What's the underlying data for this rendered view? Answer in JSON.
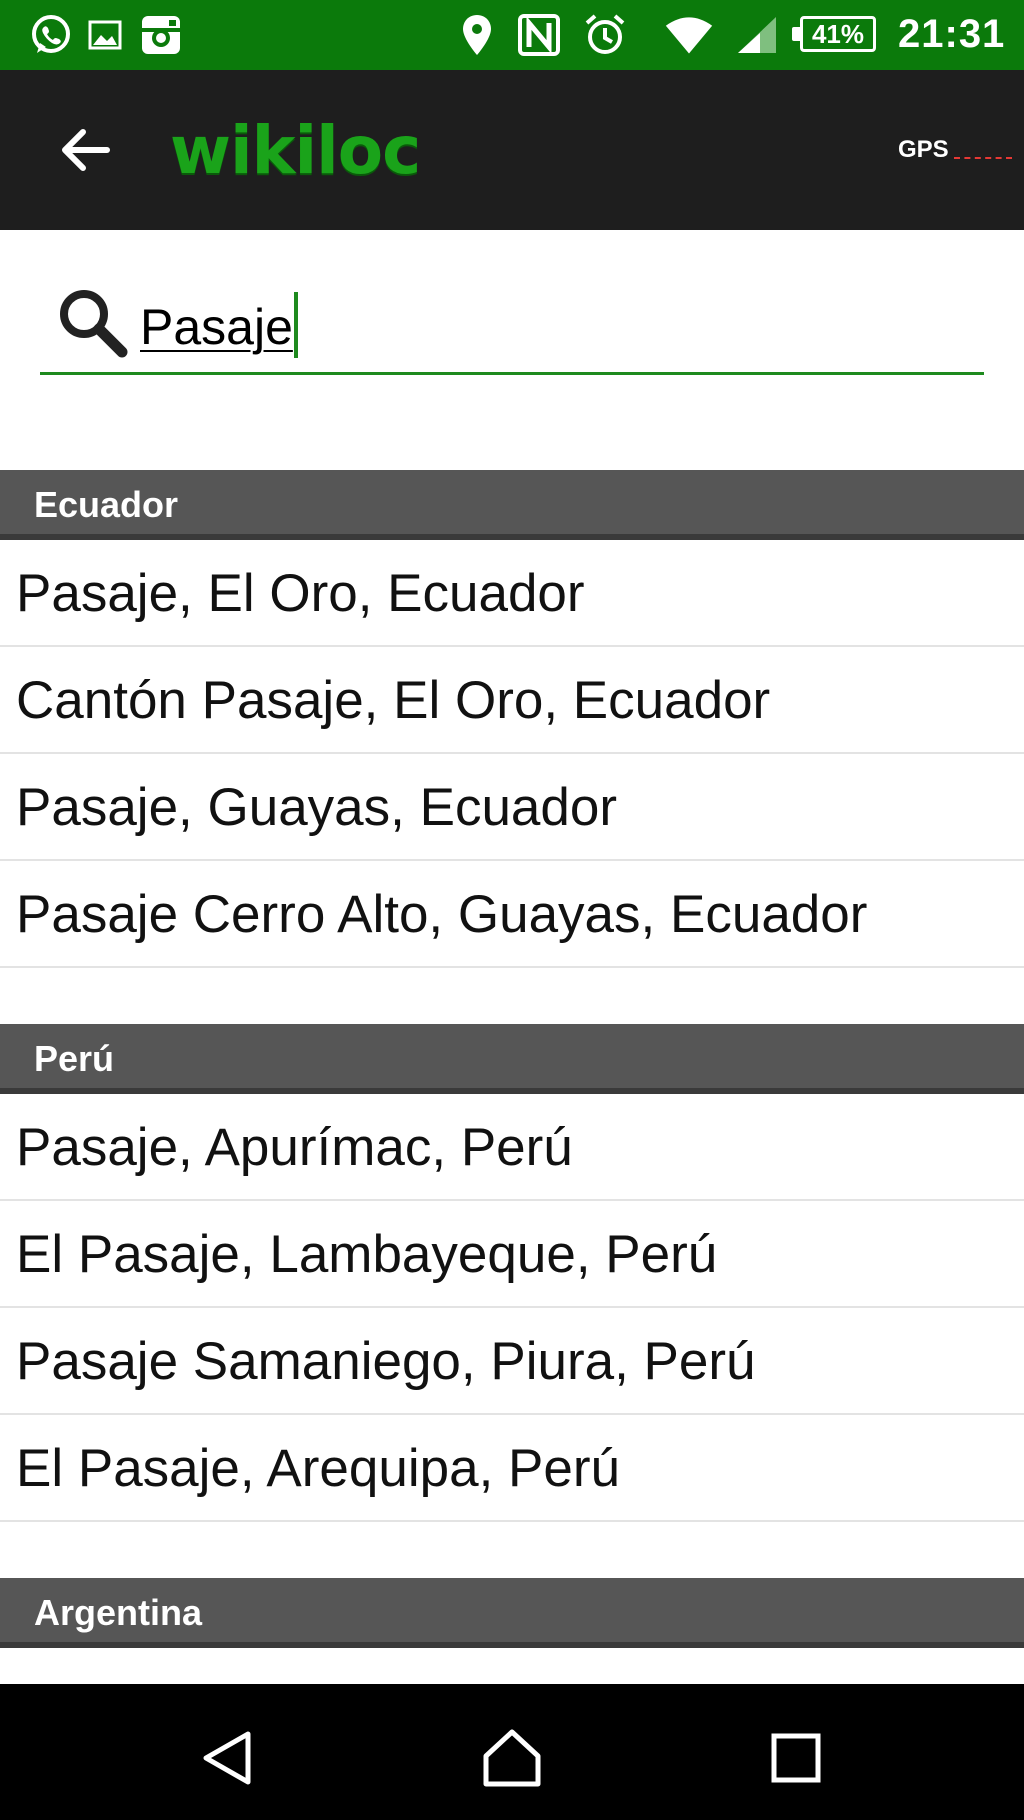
{
  "status_bar": {
    "icons": [
      "whatsapp-icon",
      "gallery-icon",
      "instagram-icon",
      "location-icon",
      "nfc-icon",
      "alarm-icon",
      "wifi-icon",
      "signal-icon"
    ],
    "battery": "41%",
    "time": "21:31",
    "background_color": "#0b7a0b"
  },
  "app_bar": {
    "logo_text": "wikiloc",
    "gps_label": "GPS",
    "background_color": "#1e1e1e"
  },
  "search": {
    "value": "Pasaje",
    "accent_color": "#1e8a1e"
  },
  "results": [
    {
      "country": "Ecuador",
      "items": [
        "Pasaje, El Oro, Ecuador",
        "Cantón Pasaje, El Oro, Ecuador",
        "Pasaje, Guayas, Ecuador",
        "Pasaje Cerro Alto, Guayas, Ecuador"
      ]
    },
    {
      "country": "Perú",
      "items": [
        "Pasaje, Apurímac, Perú",
        "El Pasaje, Lambayeque, Perú",
        "Pasaje Samaniego, Piura, Perú",
        "El Pasaje, Arequipa, Perú"
      ]
    },
    {
      "country": "Argentina",
      "items": []
    }
  ],
  "nav_bar": {
    "buttons": [
      "back-nav-icon",
      "home-nav-icon",
      "recents-nav-icon"
    ]
  }
}
